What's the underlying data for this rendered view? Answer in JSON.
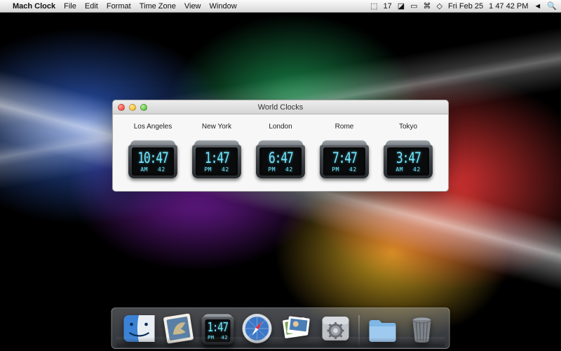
{
  "menubar": {
    "app_name": "Mach Clock",
    "items": [
      "File",
      "Edit",
      "Format",
      "Time Zone",
      "View",
      "Window"
    ],
    "right": {
      "badge_count": "17",
      "date": "Fri Feb 25",
      "time": "1 47 42 PM"
    }
  },
  "window": {
    "title": "World Clocks"
  },
  "clocks": [
    {
      "city": "Los Angeles",
      "time": "10:47",
      "ampm": "AM",
      "seconds": "42"
    },
    {
      "city": "New York",
      "time": "1:47",
      "ampm": "PM",
      "seconds": "42"
    },
    {
      "city": "London",
      "time": "6:47",
      "ampm": "PM",
      "seconds": "42"
    },
    {
      "city": "Rome",
      "time": "7:47",
      "ampm": "PM",
      "seconds": "42"
    },
    {
      "city": "Tokyo",
      "time": "3:47",
      "ampm": "AM",
      "seconds": "42"
    }
  ],
  "dock": {
    "clock": {
      "time": "1:47",
      "ampm": "PM",
      "seconds": "42"
    },
    "items": [
      {
        "name": "finder"
      },
      {
        "name": "mail"
      },
      {
        "name": "mach-clock"
      },
      {
        "name": "safari"
      },
      {
        "name": "iphoto"
      },
      {
        "name": "system-preferences"
      },
      {
        "name": "documents-folder"
      },
      {
        "name": "trash"
      }
    ]
  }
}
